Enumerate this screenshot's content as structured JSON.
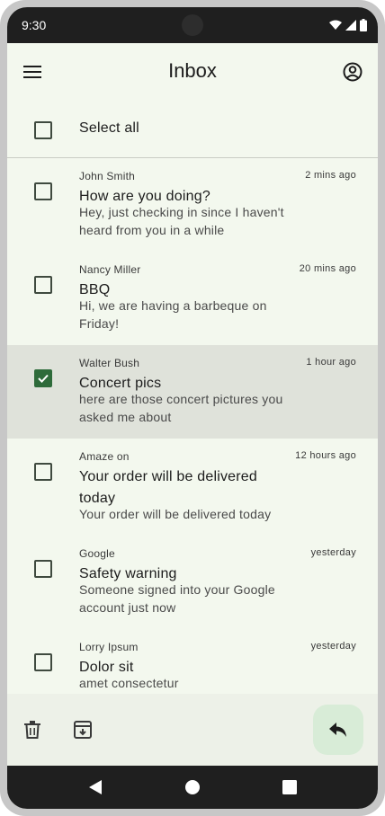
{
  "status_bar": {
    "time": "9:30"
  },
  "header": {
    "title": "Inbox"
  },
  "select_all": {
    "label": "Select all"
  },
  "emails": [
    {
      "sender": "John Smith",
      "time": "2 mins ago",
      "subject": "How are you doing?",
      "preview": "Hey, just checking in since I haven't heard from you in a while",
      "selected": false
    },
    {
      "sender": "Nancy Miller",
      "time": "20 mins ago",
      "subject": "BBQ",
      "preview": "Hi, we are having a barbeque on Friday!",
      "selected": false
    },
    {
      "sender": "Walter Bush",
      "time": "1 hour ago",
      "subject": "Concert pics",
      "preview": "here are those concert pictures you asked me about",
      "selected": true
    },
    {
      "sender": "Amaze on",
      "time": "12 hours ago",
      "subject": "Your order will be delivered today",
      "preview": "Your order will be delivered today",
      "selected": false
    },
    {
      "sender": "Google",
      "time": "yesterday",
      "subject": "Safety warning",
      "preview": "Someone signed into your Google account just now",
      "selected": false
    },
    {
      "sender": "Lorry Ipsum",
      "time": "yesterday",
      "subject": "Dolor sit",
      "preview": "amet consectetur",
      "selected": false
    }
  ],
  "icons": {
    "menu": "menu-icon",
    "account": "account-circle-icon",
    "delete": "trash-icon",
    "archive": "archive-icon",
    "reply": "reply-icon"
  },
  "colors": {
    "background": "#f3f8ee",
    "selected_row": "#dfe2da",
    "checkbox_checked": "#2e6b3a",
    "fab": "#d8ecd7",
    "system_bars": "#1f1f1f"
  }
}
